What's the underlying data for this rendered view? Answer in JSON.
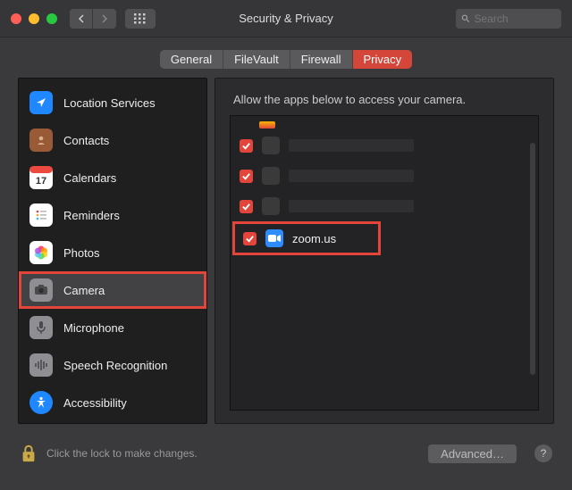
{
  "window": {
    "title": "Security & Privacy",
    "search_placeholder": "Search"
  },
  "tabs": [
    {
      "label": "General",
      "active": false
    },
    {
      "label": "FileVault",
      "active": false
    },
    {
      "label": "Firewall",
      "active": false
    },
    {
      "label": "Privacy",
      "active": true
    }
  ],
  "sidebar": {
    "items": [
      {
        "label": "Location Services",
        "icon": "location",
        "selected": false
      },
      {
        "label": "Contacts",
        "icon": "contacts",
        "selected": false
      },
      {
        "label": "Calendars",
        "icon": "calendar",
        "selected": false
      },
      {
        "label": "Reminders",
        "icon": "reminders",
        "selected": false
      },
      {
        "label": "Photos",
        "icon": "photos",
        "selected": false
      },
      {
        "label": "Camera",
        "icon": "camera",
        "selected": true
      },
      {
        "label": "Microphone",
        "icon": "microphone",
        "selected": false
      },
      {
        "label": "Speech Recognition",
        "icon": "speech",
        "selected": false
      },
      {
        "label": "Accessibility",
        "icon": "accessibility",
        "selected": false
      }
    ]
  },
  "pane": {
    "header": "Allow the apps below to access your camera.",
    "apps": [
      {
        "checked": true,
        "name": "",
        "blurred": true,
        "highlight": false
      },
      {
        "checked": true,
        "name": "",
        "blurred": true,
        "highlight": false
      },
      {
        "checked": true,
        "name": "",
        "blurred": true,
        "highlight": false
      },
      {
        "checked": true,
        "name": "zoom.us",
        "blurred": false,
        "highlight": true,
        "icon": "zoom"
      }
    ]
  },
  "footer": {
    "lock_text": "Click the lock to make changes.",
    "advanced_label": "Advanced…",
    "help_label": "?"
  },
  "colors": {
    "highlight": "#e4453b"
  }
}
